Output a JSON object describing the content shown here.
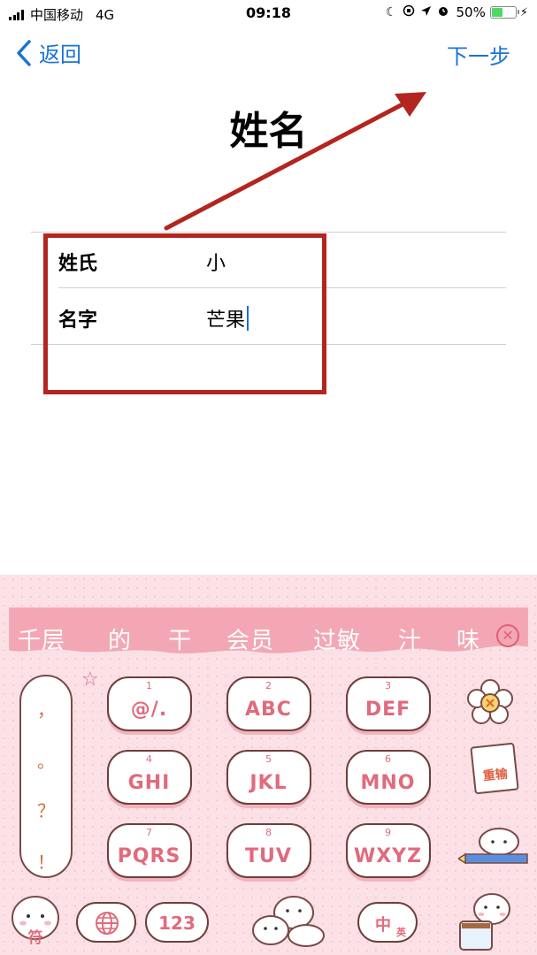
{
  "status_bar": {
    "carrier": "中国移动",
    "network": "4G",
    "time": "09:18",
    "battery_percent": "50%",
    "battery_level": 0.5,
    "icons": [
      "moon-icon",
      "orientation-lock-icon",
      "location-icon",
      "alarm-icon",
      "charging-icon"
    ]
  },
  "nav": {
    "back_label": "返回",
    "next_label": "下一步",
    "accent_color": "#1a73d9"
  },
  "page": {
    "title": "姓名"
  },
  "form": {
    "fields": [
      {
        "label": "姓氏",
        "value": "小"
      },
      {
        "label": "名字",
        "value": "芒果"
      }
    ]
  },
  "annotation": {
    "color": "#b3251f"
  },
  "keyboard": {
    "candidates": [
      "千层",
      "的",
      "干",
      "会员",
      "过敏",
      "汁",
      "味"
    ],
    "punctuation": [
      "，",
      "。",
      "？",
      "！"
    ],
    "keys": [
      {
        "num": "1",
        "letters": "@/."
      },
      {
        "num": "2",
        "letters": "ABC"
      },
      {
        "num": "3",
        "letters": "DEF"
      },
      {
        "num": "4",
        "letters": "GHI"
      },
      {
        "num": "5",
        "letters": "JKL"
      },
      {
        "num": "6",
        "letters": "MNO"
      },
      {
        "num": "7",
        "letters": "PQRS"
      },
      {
        "num": "8",
        "letters": "TUV"
      },
      {
        "num": "9",
        "letters": "WXYZ"
      }
    ],
    "bottom": {
      "symbols_label": "符",
      "numbers_label": "123",
      "lang_main": "中",
      "lang_sub": "英"
    },
    "side": {
      "reinput_label": "重输"
    },
    "accent_color": "#e16a7c"
  }
}
